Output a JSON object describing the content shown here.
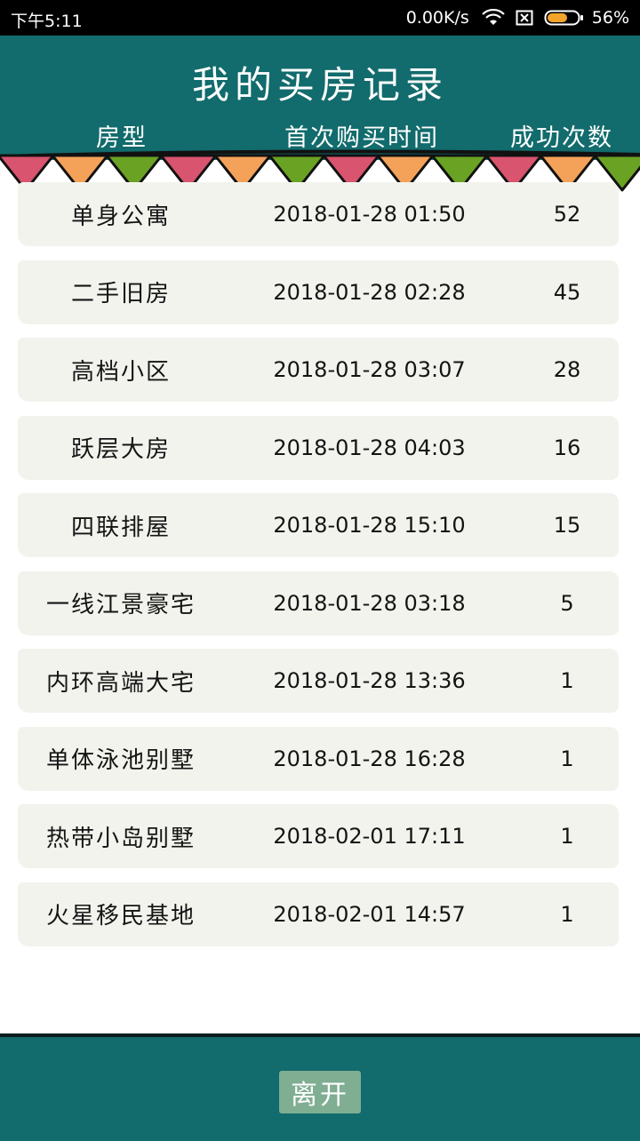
{
  "status_bar": {
    "time": "下午5:11",
    "net_speed": "0.00K/s",
    "battery": "56%",
    "icons": [
      "wifi-icon",
      "sim-icon",
      "battery-icon"
    ]
  },
  "header": {
    "title": "我的买房记录",
    "columns": {
      "type": "房型",
      "time": "首次购买时间",
      "count": "成功次数"
    }
  },
  "records": [
    {
      "type": "单身公寓",
      "time": "2018-01-28 01:50",
      "count": "52"
    },
    {
      "type": "二手旧房",
      "time": "2018-01-28 02:28",
      "count": "45"
    },
    {
      "type": "高档小区",
      "time": "2018-01-28 03:07",
      "count": "28"
    },
    {
      "type": "跃层大房",
      "time": "2018-01-28 04:03",
      "count": "16"
    },
    {
      "type": "四联排屋",
      "time": "2018-01-28 15:10",
      "count": "15"
    },
    {
      "type": "一线江景豪宅",
      "time": "2018-01-28 03:18",
      "count": "5"
    },
    {
      "type": "内环高端大宅",
      "time": "2018-01-28 13:36",
      "count": "1"
    },
    {
      "type": "单体泳池别墅",
      "time": "2018-01-28 16:28",
      "count": "1"
    },
    {
      "type": "热带小岛别墅",
      "time": "2018-02-01 17:11",
      "count": "1"
    },
    {
      "type": "火星移民基地",
      "time": "2018-02-01 14:57",
      "count": "1"
    }
  ],
  "footer": {
    "leave_label": "离开"
  },
  "colors": {
    "header_bg": "#126b6c",
    "row_bg": "#f2f3ed",
    "button_bg": "#7fae93",
    "bunting": [
      "#d9546e",
      "#f4a259",
      "#6aa224"
    ]
  }
}
